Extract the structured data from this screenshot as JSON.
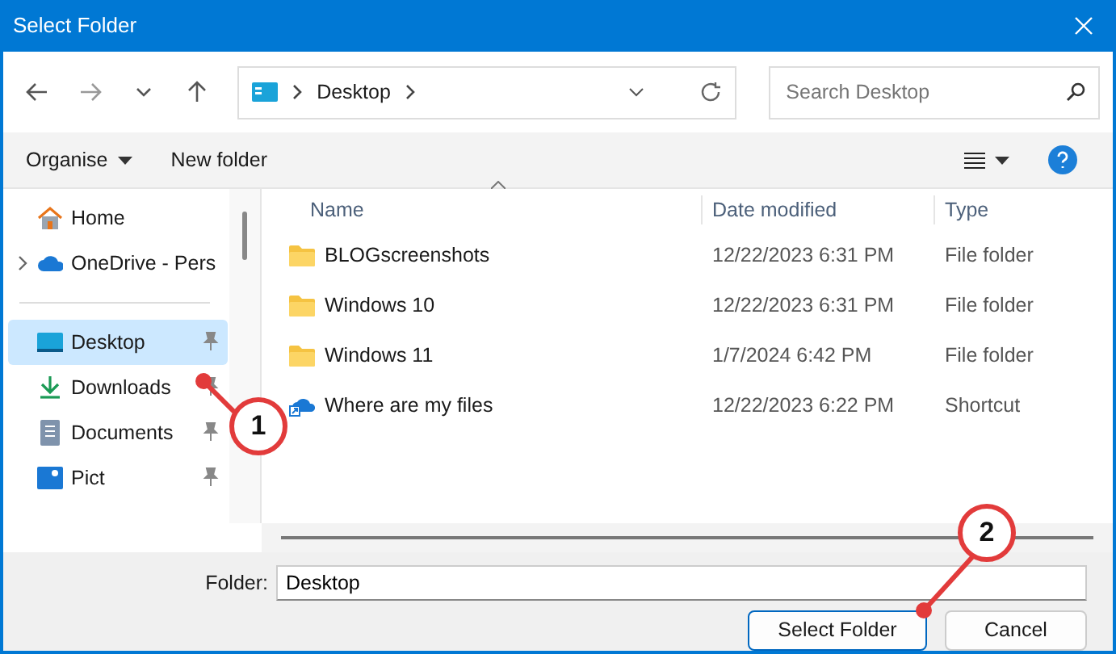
{
  "window": {
    "title": "Select Folder"
  },
  "address": {
    "segments": [
      "Desktop"
    ]
  },
  "search": {
    "placeholder": "Search Desktop"
  },
  "toolbar": {
    "organise": "Organise",
    "new_folder": "New folder"
  },
  "sidebar": {
    "items": [
      {
        "label": "Home",
        "kind": "home",
        "selected": false,
        "pinned": false,
        "expandable": false
      },
      {
        "label": "OneDrive - Pers",
        "kind": "cloud",
        "selected": false,
        "pinned": false,
        "expandable": true
      },
      {
        "label": "Desktop",
        "kind": "desktop",
        "selected": true,
        "pinned": true,
        "expandable": false
      },
      {
        "label": "Downloads",
        "kind": "download",
        "selected": false,
        "pinned": true,
        "expandable": false
      },
      {
        "label": "Documents",
        "kind": "document",
        "selected": false,
        "pinned": true,
        "expandable": false
      },
      {
        "label": "Pict",
        "kind": "picture",
        "selected": false,
        "pinned": true,
        "expandable": false
      }
    ]
  },
  "table": {
    "columns": [
      {
        "label": "Name",
        "sorted": true
      },
      {
        "label": "Date modified",
        "sorted": false
      },
      {
        "label": "Type",
        "sorted": false
      }
    ],
    "rows": [
      {
        "name": "BLOGscreenshots",
        "date": "12/22/2023 6:31 PM",
        "type": "File folder",
        "kind": "folder"
      },
      {
        "name": "Windows 10",
        "date": "12/22/2023 6:31 PM",
        "type": "File folder",
        "kind": "folder"
      },
      {
        "name": "Windows 11",
        "date": "1/7/2024 6:42 PM",
        "type": "File folder",
        "kind": "folder"
      },
      {
        "name": "Where are my files",
        "date": "12/22/2023 6:22 PM",
        "type": "Shortcut",
        "kind": "shortcut"
      }
    ]
  },
  "footer": {
    "folder_label": "Folder:",
    "folder_value": "Desktop",
    "buttons": [
      {
        "label": "Select Folder",
        "default": true
      },
      {
        "label": "Cancel",
        "default": false
      }
    ]
  },
  "callouts": [
    {
      "number": "1"
    },
    {
      "number": "2"
    }
  ]
}
